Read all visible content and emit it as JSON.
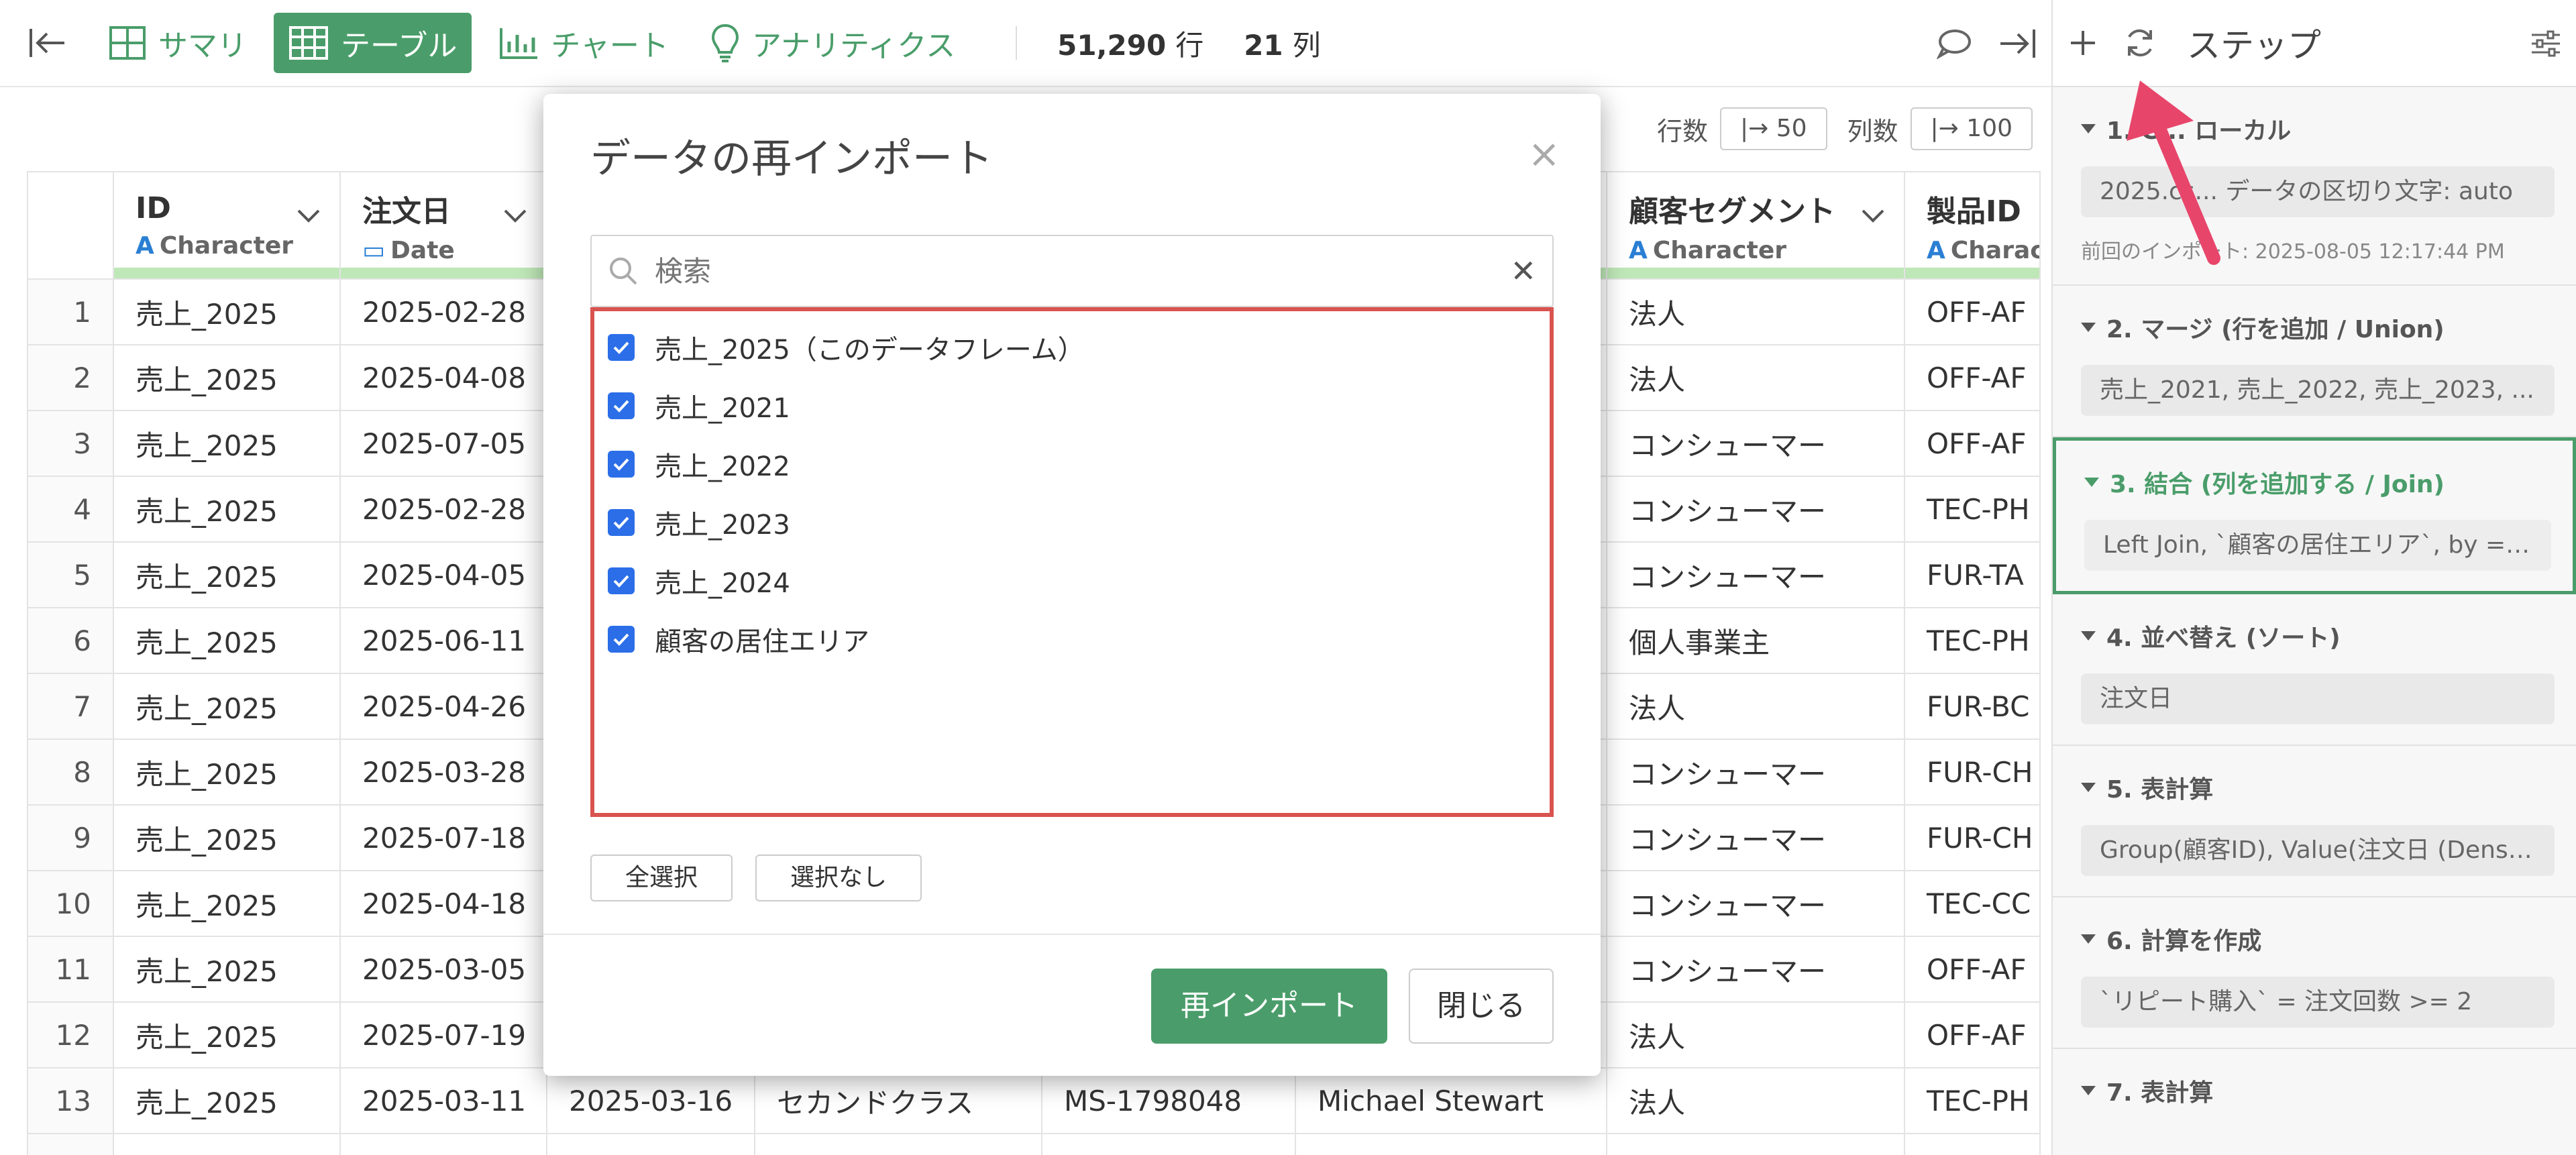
{
  "toolbar": {
    "tabs": [
      {
        "label": "サマリ",
        "icon": "summary-grid-icon",
        "active": false
      },
      {
        "label": "テーブル",
        "icon": "table-icon",
        "active": true
      },
      {
        "label": "チャート",
        "icon": "bar-chart-icon",
        "active": false
      },
      {
        "label": "アナリティクス",
        "icon": "lightbulb-icon",
        "active": false
      }
    ],
    "rows_value": "51,290",
    "rows_unit": "行",
    "cols_value": "21",
    "cols_unit": "列"
  },
  "table_tools": {
    "rows_label": "行数",
    "rows_value": "|→ 50",
    "cols_label": "列数",
    "cols_value": "|→ 100"
  },
  "table": {
    "columns": [
      {
        "name": "ID",
        "type": "Character",
        "type_icon": "character-type-icon"
      },
      {
        "name": "注文日",
        "type": "Date",
        "type_icon": "calendar-icon"
      },
      {
        "name": "顧客セグメント",
        "type": "Character",
        "type_icon": "character-type-icon"
      },
      {
        "name": "製品ID",
        "type": "Charac",
        "type_icon": "character-type-icon"
      }
    ],
    "rows": [
      {
        "n": "1",
        "id": "売上_2025",
        "date": "2025-02-28",
        "seg": "法人",
        "prod": "OFF-AF"
      },
      {
        "n": "2",
        "id": "売上_2025",
        "date": "2025-04-08",
        "seg": "法人",
        "prod": "OFF-AF"
      },
      {
        "n": "3",
        "id": "売上_2025",
        "date": "2025-07-05",
        "seg": "コンシューマー",
        "prod": "OFF-AF"
      },
      {
        "n": "4",
        "id": "売上_2025",
        "date": "2025-02-28",
        "seg": "コンシューマー",
        "prod": "TEC-PH"
      },
      {
        "n": "5",
        "id": "売上_2025",
        "date": "2025-04-05",
        "seg": "コンシューマー",
        "prod": "FUR-TA"
      },
      {
        "n": "6",
        "id": "売上_2025",
        "date": "2025-06-11",
        "seg": "個人事業主",
        "prod": "TEC-PH"
      },
      {
        "n": "7",
        "id": "売上_2025",
        "date": "2025-04-26",
        "seg": "法人",
        "prod": "FUR-BC"
      },
      {
        "n": "8",
        "id": "売上_2025",
        "date": "2025-03-28",
        "seg": "コンシューマー",
        "prod": "FUR-CH"
      },
      {
        "n": "9",
        "id": "売上_2025",
        "date": "2025-07-18",
        "seg": "コンシューマー",
        "prod": "FUR-CH"
      },
      {
        "n": "10",
        "id": "売上_2025",
        "date": "2025-04-18",
        "seg": "コンシューマー",
        "prod": "TEC-CC"
      },
      {
        "n": "11",
        "id": "売上_2025",
        "date": "2025-03-05",
        "seg": "コンシューマー",
        "prod": "OFF-AF"
      },
      {
        "n": "12",
        "id": "売上_2025",
        "date": "2025-07-19",
        "seg": "法人",
        "prod": "OFF-AF"
      },
      {
        "n": "13",
        "id": "売上_2025",
        "date": "2025-03-11",
        "seg": "法人",
        "prod": "TEC-PH",
        "extra": [
          "2025-03-16",
          "セカンドクラス",
          "MS-1798048",
          "Michael Stewart"
        ]
      }
    ]
  },
  "dialog": {
    "title": "データの再インポート",
    "search_placeholder": "検索",
    "items": [
      {
        "label": "売上_2025（このデータフレーム）",
        "checked": true
      },
      {
        "label": "売上_2021",
        "checked": true
      },
      {
        "label": "売上_2022",
        "checked": true
      },
      {
        "label": "売上_2023",
        "checked": true
      },
      {
        "label": "売上_2024",
        "checked": true
      },
      {
        "label": "顧客の居住エリア",
        "checked": true
      }
    ],
    "select_all": "全選択",
    "select_none": "選択なし",
    "reimport": "再インポート",
    "close": "閉じる"
  },
  "steps": {
    "title": "ステップ",
    "items": [
      {
        "title": "1. C... ローカル",
        "body": "2025.cs... データの区切り文字: auto",
        "note": "前回のインポート: 2025-08-05 12:17:44 PM"
      },
      {
        "title": "2. マージ (行を追加 / Union)",
        "body": "売上_2021, 売上_2022, 売上_2023, ..."
      },
      {
        "title": "3. 結合 (列を追加する / Join)",
        "body": "Left Join, `顧客の居住エリア`, by = j...",
        "selected": true
      },
      {
        "title": "4. 並べ替え (ソート)",
        "body": "注文日"
      },
      {
        "title": "5. 表計算",
        "body": "Group(顧客ID), Value(注文日 (Dense..."
      },
      {
        "title": "6. 計算を作成",
        "body": "`リピート購入` = 注文回数 >= 2"
      },
      {
        "title": "7. 表計算",
        "body": ""
      }
    ]
  },
  "colors": {
    "brand_green": "#4a9d6a",
    "highlight_red": "#d9534f",
    "checkbox_blue": "#2b6ee8",
    "annotation_arrow": "#e8456b"
  }
}
